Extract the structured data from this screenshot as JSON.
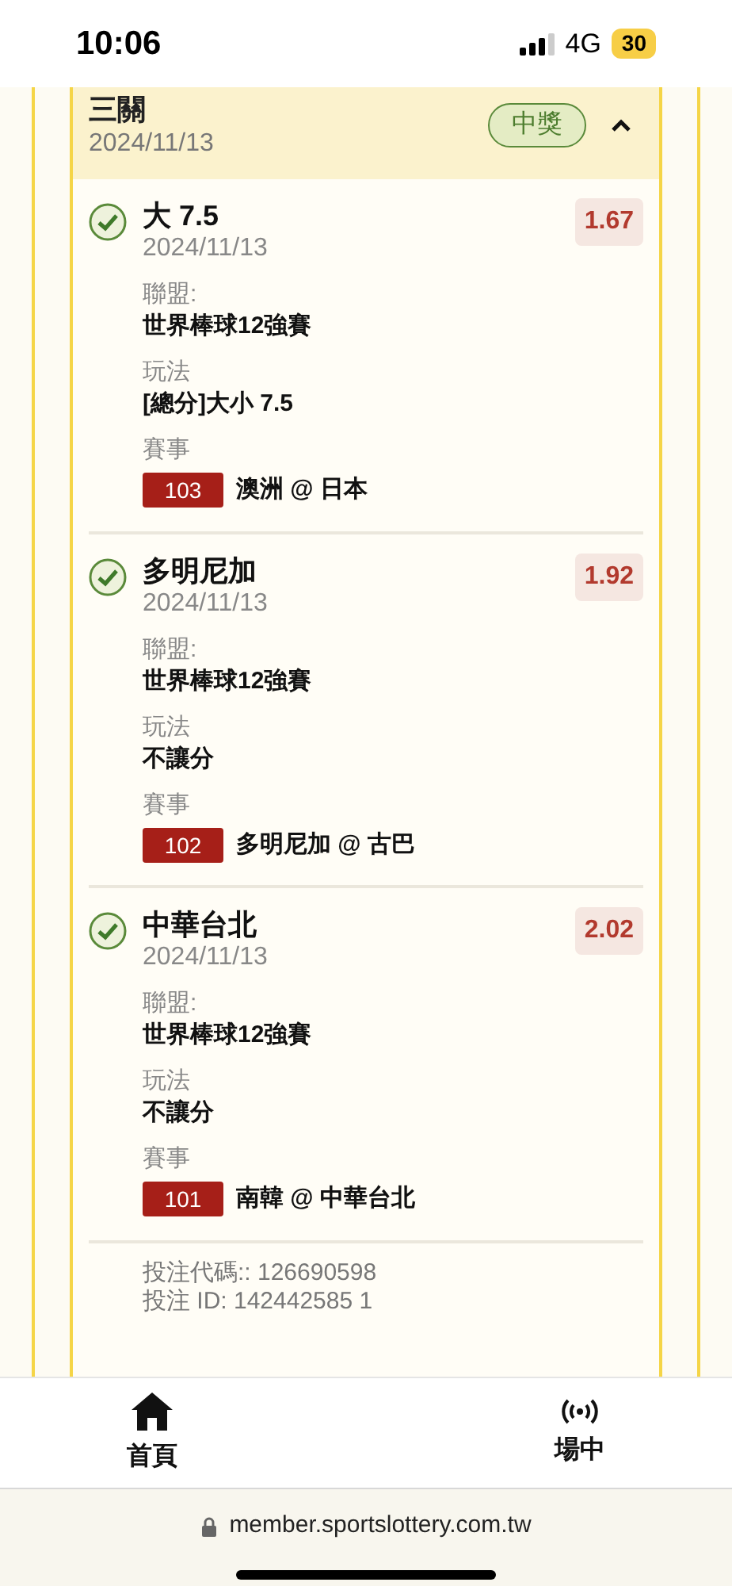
{
  "status_bar": {
    "time": "10:06",
    "network": "4G",
    "battery": "30"
  },
  "ticket": {
    "title": "三關",
    "date": "2024/11/13",
    "result": "中獎",
    "expanded": true,
    "legs": [
      {
        "pick": "大 7.5",
        "date": "2024/11/13",
        "odds": "1.67",
        "won": true,
        "league_label": "聯盟:",
        "league": "世界棒球12強賽",
        "bet_type_label": "玩法",
        "bet_type": "[總分]大小 7.5",
        "match_label": "賽事",
        "match_no": "103",
        "match": "澳洲 @ 日本"
      },
      {
        "pick": "多明尼加",
        "date": "2024/11/13",
        "odds": "1.92",
        "won": true,
        "league_label": "聯盟:",
        "league": "世界棒球12強賽",
        "bet_type_label": "玩法",
        "bet_type": "不讓分",
        "match_label": "賽事",
        "match_no": "102",
        "match": "多明尼加 @ 古巴"
      },
      {
        "pick": "中華台北",
        "date": "2024/11/13",
        "odds": "2.02",
        "won": true,
        "league_label": "聯盟:",
        "league": "世界棒球12強賽",
        "bet_type_label": "玩法",
        "bet_type": "不讓分",
        "match_label": "賽事",
        "match_no": "101",
        "match": "南韓 @ 中華台北"
      }
    ],
    "bet_code": "投注代碼:: 126690598",
    "bet_id": "投注 ID: 142442585 1"
  },
  "bottom_nav": [
    {
      "label": "首頁",
      "kind": "home"
    },
    {
      "label": "場中",
      "kind": "live"
    }
  ],
  "url_bar": {
    "url": "member.sportslottery.com.tw"
  }
}
